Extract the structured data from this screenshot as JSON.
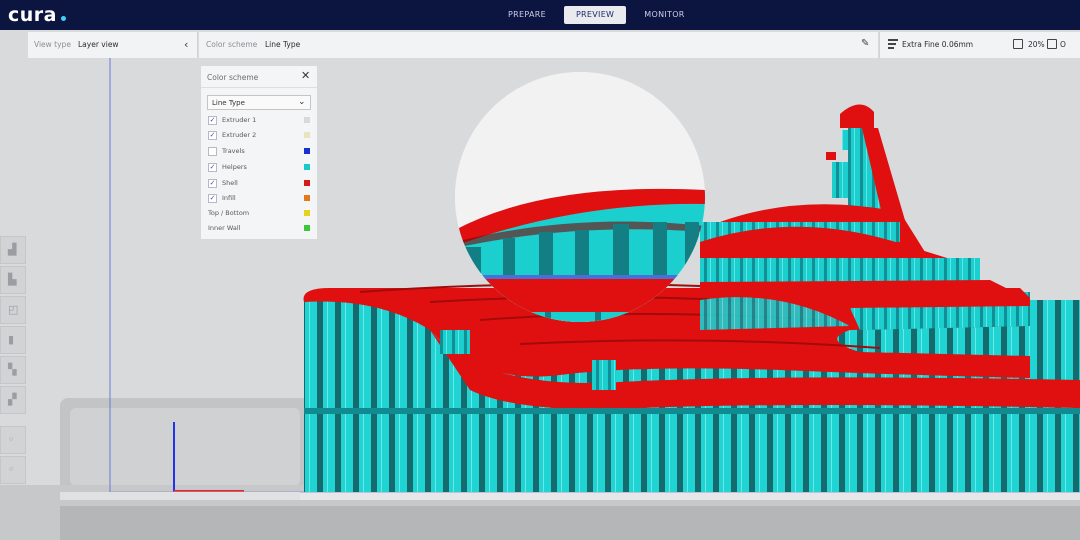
{
  "app": {
    "logo": "cura",
    "stages": [
      {
        "label": "PREPARE",
        "active": false
      },
      {
        "label": "PREVIEW",
        "active": true
      },
      {
        "label": "MONITOR",
        "active": false
      }
    ]
  },
  "toolbar": {
    "view_type_label": "View type",
    "view_type_value": "Layer view",
    "color_scheme_label": "Color scheme",
    "color_scheme_value": "Line Type",
    "profile": "Extra Fine 0.06mm",
    "infill": "20%",
    "support": "O"
  },
  "color_panel": {
    "title": "Color scheme",
    "select_value": "Line Type",
    "items": [
      {
        "label": "Extruder 1",
        "checked": true,
        "color": "#d9d9d9"
      },
      {
        "label": "Extruder 2",
        "checked": true,
        "color": "#e8e4c0"
      },
      {
        "label": "Travels",
        "checked": false,
        "color": "#1a2fd0"
      },
      {
        "label": "Helpers",
        "checked": true,
        "color": "#19c8c8"
      },
      {
        "label": "Shell",
        "checked": true,
        "color": "#d61a1a"
      },
      {
        "label": "Infill",
        "checked": true,
        "color": "#e07a1a"
      },
      {
        "label": "Top / Bottom",
        "checked": null,
        "color": "#e6d21a"
      },
      {
        "label": "Inner Wall",
        "checked": null,
        "color": "#3ac73a"
      }
    ]
  },
  "colors": {
    "header": "#0c1440",
    "shell_red": "#e01010",
    "helper_cyan": "#1ad0d0"
  }
}
